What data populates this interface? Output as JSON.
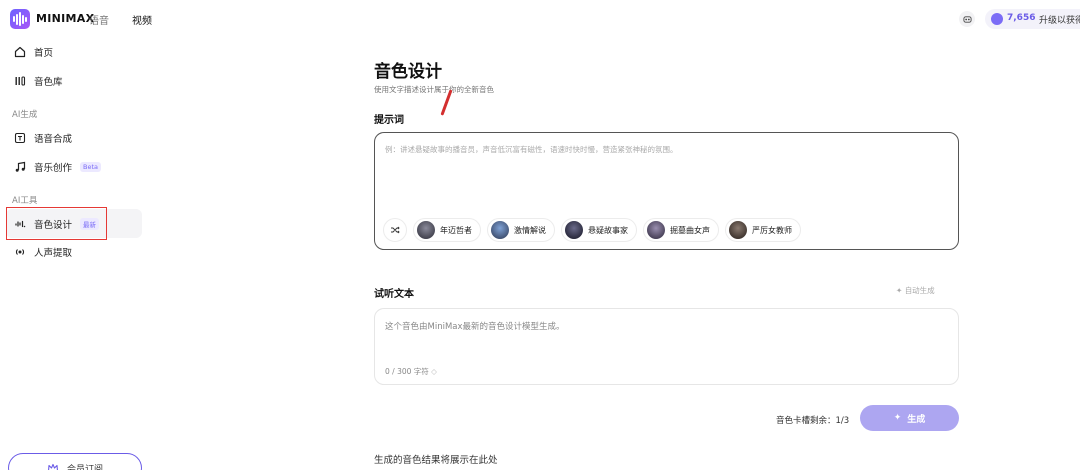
{
  "topbar": {
    "brand": "MINIMAX",
    "nav_voice": "语音",
    "nav_video": "视频",
    "credits": "7,656",
    "upgrade_label": "升级以获得",
    "accent_color": "#7b6cf6"
  },
  "sidebar": {
    "items": [
      {
        "label": "首页",
        "icon": "home-icon"
      },
      {
        "label": "音色库",
        "icon": "library-icon"
      },
      {
        "label": "语音合成",
        "icon": "tts-icon"
      },
      {
        "label": "音乐创作",
        "icon": "music-icon",
        "badge": "Beta"
      },
      {
        "label": "音色设计",
        "icon": "voice-design-icon",
        "badge": "最新"
      },
      {
        "label": "人声提取",
        "icon": "vocal-extract-icon"
      }
    ],
    "sections": [
      "AI生成",
      "AI工具"
    ],
    "member_button": "会员订阅"
  },
  "main": {
    "title": "音色设计",
    "subtitle": "使用文字描述设计属于你的全新音色",
    "prompt_label": "提示词",
    "prompt_placeholder": "例：讲述悬疑故事的播音员，声音低沉富有磁性，语速时快时慢，营造紧张神秘的氛围。",
    "chips": [
      "年迈哲者",
      "激情解说",
      "悬疑故事家",
      "掘墓曲女声",
      "严厉女教师"
    ],
    "listen_label": "试听文本",
    "auto_generate": "自动生成",
    "listen_text": "这个音色由MiniMax最新的音色设计模型生成。",
    "char_count": "0 / 300 字符",
    "remain_label": "音色卡槽剩余：",
    "remain_value": "1/3",
    "generate_button": "生成",
    "result_hint": "生成的音色结果将展示在此处"
  }
}
